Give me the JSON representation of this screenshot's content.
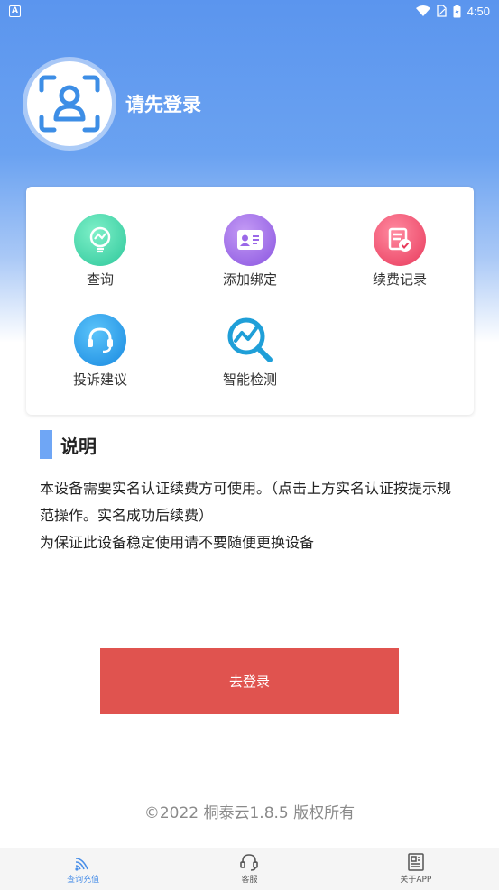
{
  "status_bar": {
    "time": "4:50",
    "left_icon": "A"
  },
  "user": {
    "login_prompt": "请先登录"
  },
  "features": [
    {
      "label": "查询",
      "icon": "query-icon",
      "color": "#3fd0a6"
    },
    {
      "label": "添加绑定",
      "icon": "id-card-icon",
      "color": "#9b68e8"
    },
    {
      "label": "续费记录",
      "icon": "record-icon",
      "color": "#f04f6b"
    },
    {
      "label": "投诉建议",
      "icon": "headset-icon",
      "color": "#1e9ae8"
    },
    {
      "label": "智能检测",
      "icon": "search-chart-icon",
      "color": "#1f9fd8"
    }
  ],
  "notice": {
    "title": "说明",
    "line1": "本设备需要实名认证续费方可使用。（点击上方实名认证按提示规范操作。实名成功后续费）",
    "line2": "为保证此设备稳定使用请不要随便更换设备"
  },
  "login_button": {
    "label": "去登录"
  },
  "copyright": "©2022 桐泰云1.8.5 版权所有",
  "tabs": [
    {
      "label": "查询充值",
      "icon": "wifi-icon",
      "active": true
    },
    {
      "label": "客服",
      "icon": "headset-icon"
    },
    {
      "label": "关于APP",
      "icon": "newspaper-icon"
    }
  ],
  "colors": {
    "accent": "#4a8fe8",
    "button": "#e0534f",
    "title_bar": "#6fa6f5"
  }
}
